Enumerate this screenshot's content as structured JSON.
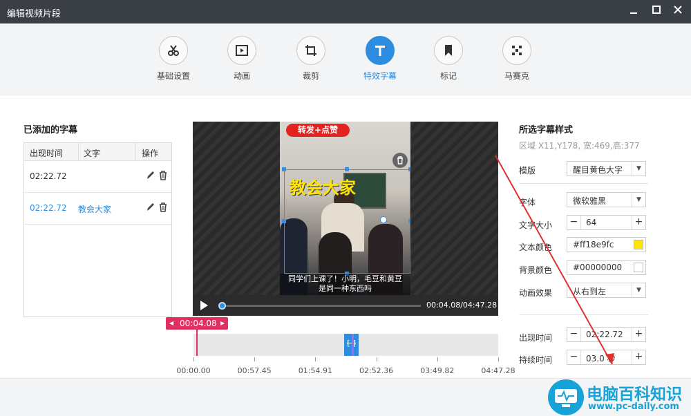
{
  "window": {
    "title": "编辑视频片段"
  },
  "toolbar": {
    "tools": [
      {
        "label": "基础设置",
        "icon": "scissors-icon"
      },
      {
        "label": "动画",
        "icon": "play-frame-icon"
      },
      {
        "label": "裁剪",
        "icon": "crop-icon"
      },
      {
        "label": "特效字幕",
        "icon": "text-t-icon"
      },
      {
        "label": "标记",
        "icon": "bookmark-icon"
      },
      {
        "label": "马赛克",
        "icon": "mosaic-icon"
      }
    ],
    "active_index": 3
  },
  "subtitles": {
    "title": "已添加的字幕",
    "columns": [
      "出现时间",
      "文字",
      "操作"
    ],
    "rows": [
      {
        "time": "02:22.72",
        "text": ""
      },
      {
        "time": "02:22.72",
        "text": "教会大家"
      }
    ]
  },
  "video": {
    "banner": "转发+点赞",
    "overlay_text": "教会大家",
    "caption_line1": "同学们上课了！小明，毛豆和黄豆",
    "caption_line2": "是同一种东西吗",
    "time": "00:04.08/04:47.28",
    "progress": 0.0142
  },
  "timeline": {
    "current": "00:04.08",
    "ticks": [
      "00:00.00",
      "00:57.45",
      "01:54.91",
      "02:52.36",
      "03:49.82",
      "04:47.28"
    ],
    "clip_start": 0.4945,
    "clip_end": 0.5419
  },
  "style_panel": {
    "title": "所选字幕样式",
    "region": "区域 X11,Y178, 宽:469,高:377",
    "template_label": "模版",
    "template_value": "醒目黄色大字",
    "font_label": "字体",
    "font_value": "微软雅黑",
    "size_label": "文字大小",
    "size_value": "64",
    "color_label": "文本颜色",
    "color_value": "#ff18e9fc",
    "bg_label": "背景颜色",
    "bg_value": "#00000000",
    "anim_label": "动画效果",
    "anim_value": "从右到左",
    "appear_label": "出现时间",
    "appear_value": "02:22.72",
    "duration_label": "持续时间",
    "duration_value": "03.0  秒"
  },
  "watermark": {
    "name": "电脑百科知识",
    "url": "www.pc-daily.com"
  },
  "colors": {
    "accent": "#2e8de1",
    "titlebar": "#3a3f46",
    "timeline_marker": "#e0305f",
    "text_yellow": "#ffe600"
  }
}
